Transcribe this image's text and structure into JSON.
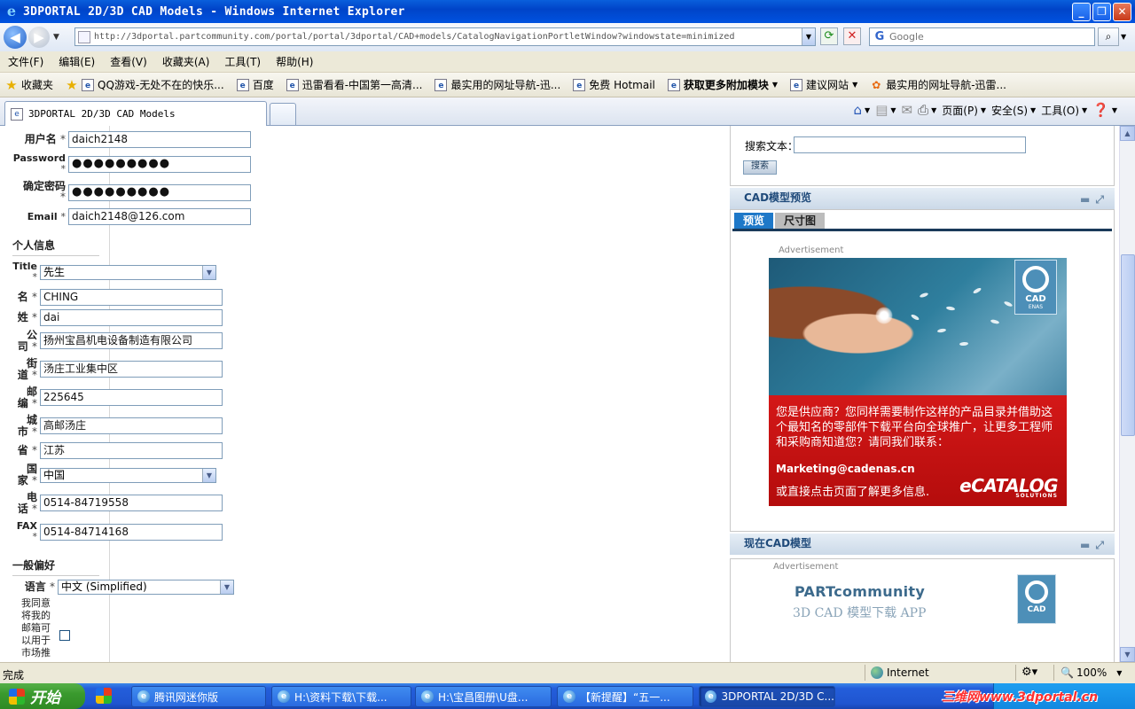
{
  "window": {
    "title": "3DPORTAL 2D/3D CAD Models - Windows Internet Explorer"
  },
  "address": {
    "url": "http://3dportal.partcommunity.com/portal/portal/3dportal/CAD+models/CatalogNavigationPortletWindow?windowstate=minimized",
    "search_placeholder": "Google"
  },
  "menu": [
    "文件(F)",
    "编辑(E)",
    "查看(V)",
    "收藏夹(A)",
    "工具(T)",
    "帮助(H)"
  ],
  "favorites": {
    "label": "收藏夹",
    "items": [
      "QQ游戏-无处不在的快乐...",
      "百度",
      "迅雷看看-中国第一高清...",
      "最实用的网址导航-迅...",
      "免费 Hotmail",
      "获取更多附加模块",
      "建议网站",
      "最实用的网址导航-迅雷..."
    ]
  },
  "tab": {
    "label": "3DPORTAL 2D/3D CAD Models"
  },
  "commands": {
    "page": "页面(P)",
    "safety": "安全(S)",
    "tools": "工具(O)"
  },
  "form": {
    "username": {
      "label": "用户名",
      "value": "daich2148"
    },
    "password": {
      "label": "Password",
      "value": "●●●●●●●●●"
    },
    "confirm": {
      "label": "确定密码",
      "value": "●●●●●●●●●"
    },
    "email": {
      "label": "Email",
      "value": "daich2148@126.com"
    },
    "personal_title": "个人信息",
    "title_field": {
      "label": "Title",
      "value": "先生"
    },
    "first_name": {
      "label": "名",
      "value": "CHING"
    },
    "last_name": {
      "label": "姓",
      "value": "dai"
    },
    "company": {
      "label1": "公",
      "label2": "司",
      "value": "扬州宝昌机电设备制造有限公司"
    },
    "street": {
      "label1": "街",
      "label2": "道",
      "value": "汤庄工业集中区"
    },
    "zip": {
      "label1": "邮",
      "label2": "编",
      "value": "225645"
    },
    "city": {
      "label1": "城",
      "label2": "市",
      "value": "高邮汤庄"
    },
    "province": {
      "label": "省",
      "value": "江苏"
    },
    "country": {
      "label1": "国",
      "label2": "家",
      "value": "中国"
    },
    "phone": {
      "label1": "电",
      "label2": "话",
      "value": "0514-84719558"
    },
    "fax": {
      "label": "FAX",
      "value": "0514-84714168"
    },
    "prefs_title": "一般偏好",
    "language": {
      "label": "语言",
      "value": "中文 (Simplified)"
    },
    "marketing_label": [
      "我同意",
      "将我的",
      "邮箱可",
      "以用于",
      "市场推"
    ],
    "required_mark": "*"
  },
  "right": {
    "search_label": "搜索文本：",
    "search_button": "搜索",
    "preview_header": "CAD模型预览",
    "tabs": [
      "预览",
      "尺寸图"
    ],
    "ad_label": "Advertisement",
    "ad": {
      "logo": "CAD",
      "logo_sub": "ENAS",
      "text1": "您是供应商？您同样需要制作这样的产品目录并借助这个最知名的零部件下载平台向全球推广，让更多工程师和采购商知道您？请同我们联系：",
      "email": "Marketing@cadenas.cn",
      "text2": "或直接点击页面了解更多信息.",
      "brand": "eCATALOG",
      "brand_sub": "SOLUTIONS"
    },
    "now_header": "现在CAD模型",
    "pc": {
      "title": "PARTcommunity",
      "subtitle": "3D CAD 模型下载 APP",
      "logo": "CAD"
    }
  },
  "status": {
    "text": "完成",
    "zone": "Internet",
    "zoom": "100%"
  },
  "taskbar": {
    "start": "开始",
    "tasks": [
      "腾讯网迷你版",
      "H:\\资料下载\\下载...",
      "H:\\宝昌图册\\U盘...",
      "【新提醒】“五一...",
      "3DPORTAL 2D/3D C..."
    ]
  },
  "watermark": "三维网www.3dportal.cn"
}
